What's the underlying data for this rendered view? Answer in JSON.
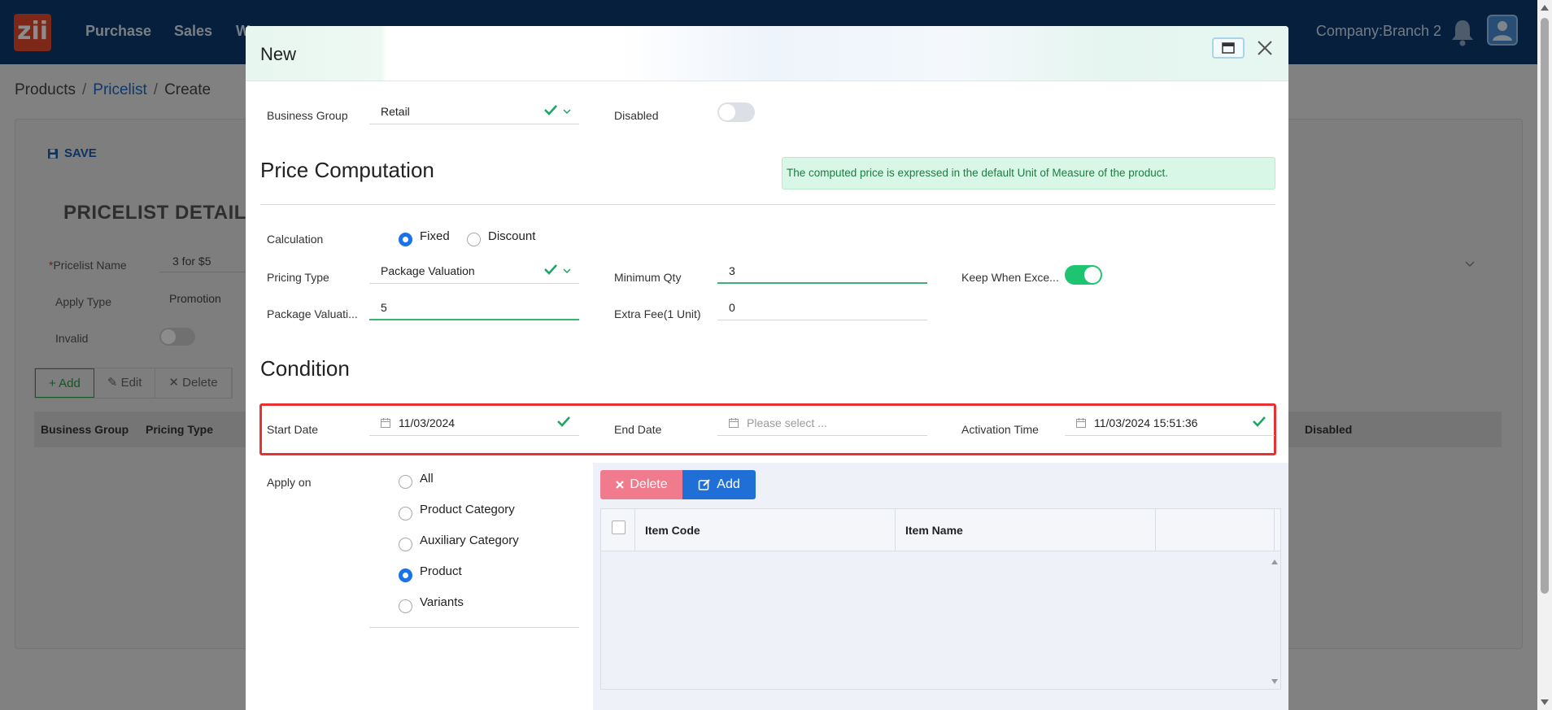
{
  "app": {
    "logo_text": "zii",
    "nav": [
      "Purchase",
      "Sales",
      "W"
    ],
    "company": "Company:Branch 2"
  },
  "breadcrumb": {
    "items": [
      "Products",
      "Pricelist",
      "Create"
    ]
  },
  "background_form": {
    "save_label": "SAVE",
    "title": "PRICELIST DETAIL",
    "fields": {
      "pricelist_name_label": "Pricelist Name",
      "pricelist_name_value": "3 for $5",
      "apply_type_label": "Apply Type",
      "apply_type_value": "Promotion",
      "invalid_label": "Invalid"
    },
    "actions": {
      "add": "Add",
      "edit": "Edit",
      "delete": "Delete"
    },
    "table_headers": {
      "business_group": "Business Group",
      "pricing_type": "Pricing Type",
      "disabled": "Disabled"
    }
  },
  "modal": {
    "title": "New",
    "business_group": {
      "label": "Business Group",
      "value": "Retail"
    },
    "disabled": {
      "label": "Disabled",
      "on": false
    },
    "price_computation": {
      "heading": "Price Computation",
      "info": "The computed price is expressed in the default Unit of Measure of the product.",
      "calculation": {
        "label": "Calculation",
        "options": [
          "Fixed",
          "Discount"
        ],
        "selected": "Fixed"
      },
      "pricing_type": {
        "label": "Pricing Type",
        "value": "Package Valuation"
      },
      "minimum_qty": {
        "label": "Minimum Qty",
        "value": "3"
      },
      "keep_when_exceed": {
        "label": "Keep When Exce...",
        "on": true
      },
      "package_valuation": {
        "label": "Package Valuati...",
        "value": "5"
      },
      "extra_fee": {
        "label": "Extra Fee(1 Unit)",
        "value": "0"
      }
    },
    "condition": {
      "heading": "Condition",
      "start_date": {
        "label": "Start Date",
        "value": "11/03/2024"
      },
      "end_date": {
        "label": "End Date",
        "placeholder": "Please select ..."
      },
      "activation_time": {
        "label": "Activation Time",
        "value": "11/03/2024 15:51:36"
      },
      "apply_on": {
        "label": "Apply on",
        "options": [
          "All",
          "Product Category",
          "Auxiliary Category",
          "Product",
          "Variants"
        ],
        "selected": "Product"
      }
    },
    "item_table": {
      "delete_label": "Delete",
      "add_label": "Add",
      "columns": [
        "Item Code",
        "Item Name"
      ]
    }
  },
  "colors": {
    "topbar": "#0a3a6e",
    "logo": "#e2472a",
    "accent_blue": "#1a73e8",
    "success_green": "#1ec46f",
    "highlight_red": "#e63232",
    "delete_pink": "#ef7b8c"
  },
  "icons": [
    "bell-icon",
    "user-avatar-icon",
    "save-icon",
    "check-icon",
    "chevron-down-icon",
    "calendar-icon",
    "maximize-icon",
    "close-icon",
    "plus-icon",
    "pencil-icon",
    "x-icon",
    "edit-square-icon"
  ]
}
